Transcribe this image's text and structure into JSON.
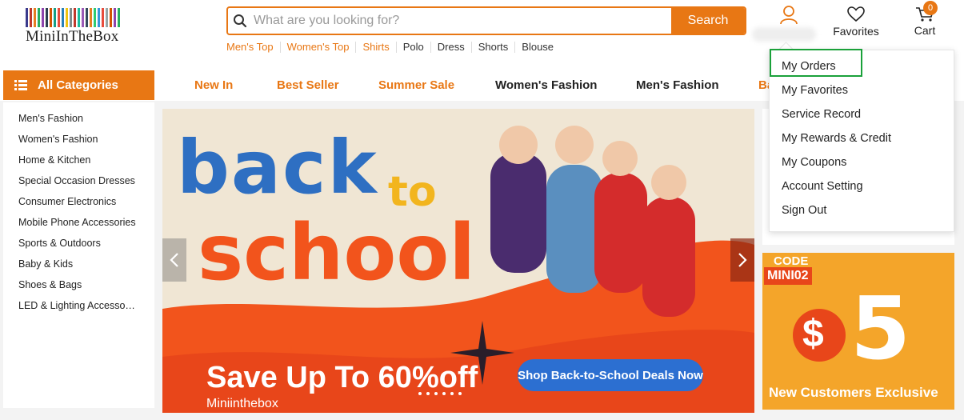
{
  "brand": {
    "logo_text": "MiniInTheBox",
    "logo_stripes": [
      "#3a3a8c",
      "#c0392b",
      "#e67e22",
      "#27ae60",
      "#8e44ad",
      "#2c3e50",
      "#d35400",
      "#16a085",
      "#e74c3c",
      "#2980b9",
      "#f1c40f",
      "#7f8c8d",
      "#c0392b",
      "#1abc9c",
      "#9b59b6",
      "#34495e",
      "#e67e22",
      "#2ecc71",
      "#3498db",
      "#e74c3c",
      "#95a5a6",
      "#d35400",
      "#8e44ad",
      "#27ae60"
    ]
  },
  "search": {
    "placeholder": "What are you looking for?",
    "button_label": "Search"
  },
  "hot_searches": [
    "Men's Top",
    "Women's Top",
    "Shirts",
    "Polo",
    "Dress",
    "Shorts",
    "Blouse"
  ],
  "header": {
    "favorites_label": "Favorites",
    "cart_label": "Cart",
    "cart_count": "0"
  },
  "nav": {
    "all_categories_label": "All Categories",
    "links": [
      "New In",
      "Best Seller",
      "Summer Sale",
      "Women's Fashion",
      "Men's Fashion",
      "Ba"
    ]
  },
  "categories": [
    "Men's Fashion",
    "Women's Fashion",
    "Home & Kitchen",
    "Special Occasion Dresses",
    "Consumer Electronics",
    "Mobile Phone Accessories",
    "Sports & Outdoors",
    "Baby & Kids",
    "Shoes & Bags",
    "LED & Lighting Accessories"
  ],
  "banner": {
    "line1": "back",
    "line1_accent": "to",
    "line2": "school",
    "headline": "Save Up To 60%off",
    "cta_label": "Shop Back-to-School Deals Now",
    "brand_caption": "Miniinthebox"
  },
  "account_menu": {
    "items": [
      "My Orders",
      "My Favorites",
      "Service Record",
      "My Rewards & Credit",
      "My Coupons",
      "Account Setting",
      "Sign Out"
    ]
  },
  "coupon": {
    "code_label": "CODE",
    "code_value": "MINI02",
    "amount_symbol": "$",
    "amount_value": "5",
    "caption": "New Customers Exclusive"
  },
  "colors": {
    "accent": "#e87714",
    "highlight": "#1aa13a",
    "cta_blue": "#2c6fd1"
  }
}
